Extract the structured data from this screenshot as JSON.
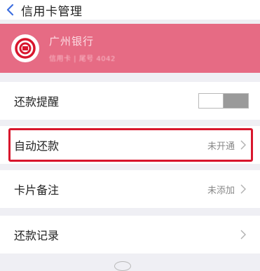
{
  "header": {
    "title": "信用卡管理"
  },
  "card": {
    "bank_name": "广州银行",
    "card_number": "信用卡 | 尾号 4042"
  },
  "rows": [
    {
      "label": "还款提醒",
      "value": "",
      "control": "toggle"
    },
    {
      "label": "自动还款",
      "value": "未开通",
      "control": "chevron"
    },
    {
      "label": "卡片备注",
      "value": "未添加",
      "control": "chevron"
    },
    {
      "label": "还款记录",
      "value": "",
      "control": "chevron"
    }
  ],
  "icons": {
    "back": "chevron-left-icon",
    "bank_logo": "bank-logo-icon",
    "chevron": "chevron-right-icon"
  },
  "colors": {
    "accent": "#3d6fe0",
    "card_bg": "#e66b84",
    "highlight": "#d8162d"
  }
}
